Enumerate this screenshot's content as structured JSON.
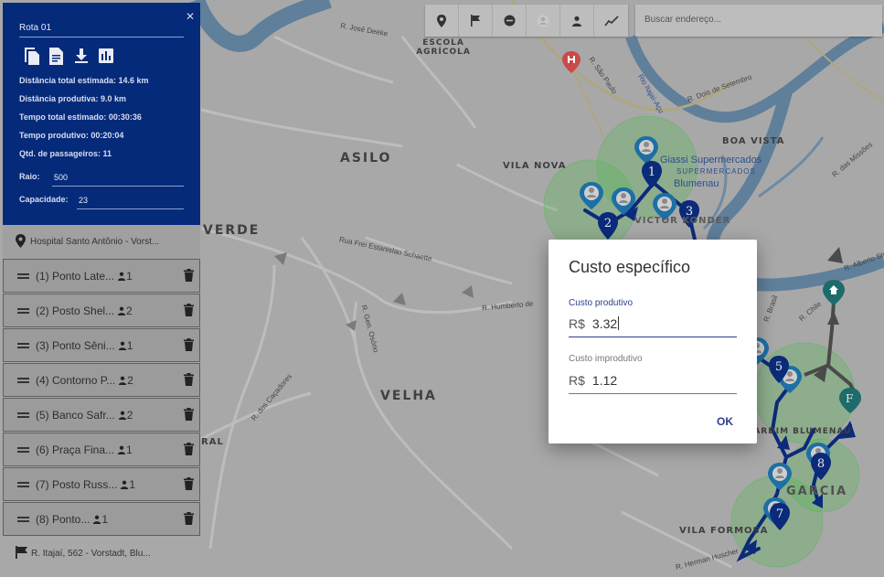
{
  "map": {
    "place_labels": [
      "ASILO",
      "VILA NOVA",
      "VICTOR KONDER",
      "BOA VISTA",
      "VELHA",
      "GARCIA",
      "VILA FORMOSA",
      "JARDIM BLUMENAU",
      "ESCOLA AGRÍCOLA",
      "VERDE",
      "RAL",
      "SUPERMERCADOS"
    ],
    "street_labels": [
      "R. José Deeke",
      "R. São Paulo",
      "Rio Itajaí-Açu",
      "R. Dois de Setembro",
      "R. das Missões",
      "Rua Frei Estanislau Schaette",
      "R. Humberto de",
      "R. dos Caçadores",
      "R. Gen. Osório",
      "R. Herman Huscher",
      "R. Chile",
      "R. Brasil",
      "R. Alberto Stein",
      "Giassi Supermercados",
      "Blumenau"
    ],
    "marker_numbers": [
      "1",
      "2",
      "3",
      "5",
      "7",
      "8"
    ],
    "end_marker_label": "F",
    "route_color": "#0b2a7a",
    "area_color": "#4caf50"
  },
  "toolbar": {
    "icons": [
      "map-pin-icon",
      "flag-icon",
      "minus-circle-icon",
      "user-circle-icon",
      "person-icon",
      "trend-line-icon"
    ],
    "search_placeholder": "Buscar endereço..."
  },
  "panel": {
    "route_name": "Rota 01",
    "action_icons": [
      "copy-icon",
      "document-icon",
      "download-icon",
      "bar-chart-icon"
    ],
    "stats": [
      "Distância total estimada: 14.6 km",
      "Distância produtiva: 9.0 km",
      "Tempo total estimado: 00:30:36",
      "Tempo produtivo: 00:20:04",
      "Qtd. de passageiros: 11"
    ],
    "raio_label": "Raio:",
    "raio_value": "500",
    "capacidade_label": "Capacidade:",
    "capacidade_value": "23",
    "panel_color": "#052a7a"
  },
  "origin": {
    "label": "Hospital Santo Antônio - Vorst..."
  },
  "stops": [
    {
      "label": "(1) Ponto Late...",
      "pax": "1"
    },
    {
      "label": "(2) Posto Shel...",
      "pax": "2"
    },
    {
      "label": "(3) Ponto Sêni...",
      "pax": "1"
    },
    {
      "label": "(4) Contorno P...",
      "pax": "2"
    },
    {
      "label": "(5) Banco Safr...",
      "pax": "2"
    },
    {
      "label": "(6) Praça Fina...",
      "pax": "1"
    },
    {
      "label": "(7) Posto Russ...",
      "pax": "1"
    },
    {
      "label": "(8) Ponto...",
      "pax": "1"
    }
  ],
  "destination": {
    "label": "R. Itajaí, 562 - Vorstadt, Blu..."
  },
  "dialog": {
    "title": "Custo específico",
    "productive_label": "Custo produtivo",
    "productive_currency": "R$",
    "productive_value": "3.32",
    "unproductive_label": "Custo improdutivo",
    "unproductive_currency": "R$",
    "unproductive_value": "1.12",
    "ok_label": "OK",
    "accent_color": "#2c3f8a"
  }
}
